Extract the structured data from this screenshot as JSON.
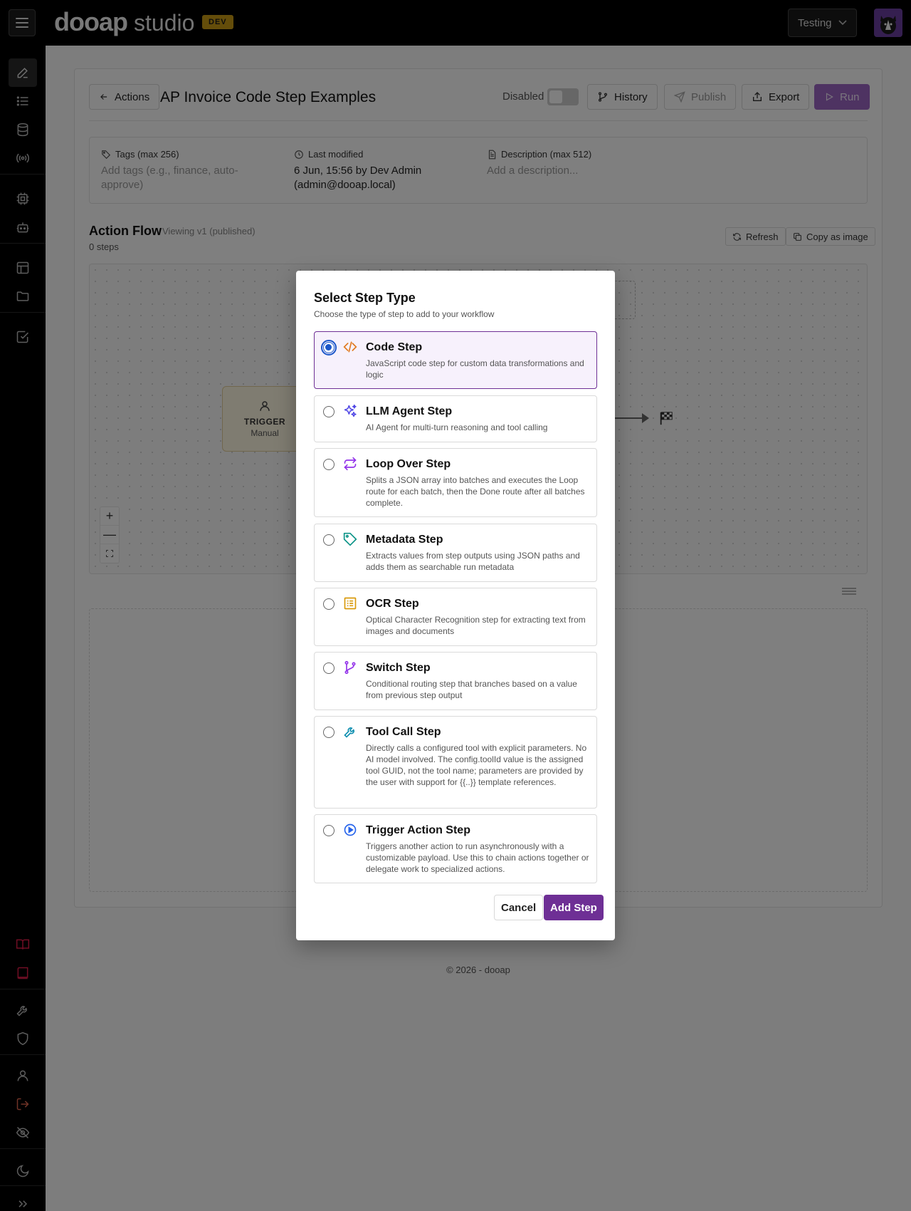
{
  "header": {
    "logo_bold": "dooap",
    "logo_rest": "studio",
    "env_badge": "DEV",
    "environment": "Testing",
    "menu_icon": "hamburger-icon",
    "avatar_icon": "dog-avatar"
  },
  "sidebar": {
    "items": [
      {
        "icon": "pencil-icon",
        "active": true
      },
      {
        "icon": "list-icon"
      },
      {
        "icon": "database-icon"
      },
      {
        "icon": "broadcast-icon"
      },
      {
        "icon": "cpu-icon"
      },
      {
        "icon": "bot-icon"
      },
      {
        "icon": "table-icon"
      },
      {
        "icon": "folder-icon"
      },
      {
        "icon": "checkbox-icon"
      },
      {
        "icon": "book-open-icon",
        "color": "#e11d48"
      },
      {
        "icon": "book-icon",
        "color": "#e11d48"
      },
      {
        "icon": "wrench-icon"
      },
      {
        "icon": "shield-icon"
      },
      {
        "icon": "user-icon"
      },
      {
        "icon": "logout-icon",
        "color": "#e0674e"
      },
      {
        "icon": "eye-off-icon"
      },
      {
        "icon": "moon-icon"
      },
      {
        "icon": "chevrons-right-icon"
      }
    ]
  },
  "page": {
    "back_label": "Actions",
    "title": "AP Invoice Code Step Examples",
    "disabled_label": "Disabled",
    "history_label": "History",
    "publish_label": "Publish",
    "export_label": "Export",
    "run_label": "Run"
  },
  "meta": {
    "tags_label": "Tags (max 256)",
    "tags_placeholder_line1": "Add tags (e.g., finance, auto-",
    "tags_placeholder_line2": "approve)",
    "modified_label": "Last modified",
    "modified_line1": "6 Jun, 15:56 by Dev Admin",
    "modified_line2": "(admin@dooap.local)",
    "desc_label": "Description (max 512)",
    "desc_placeholder": "Add a description..."
  },
  "flow": {
    "title": "Action Flow",
    "version": "Viewing v1 (published)",
    "steps_count": "0 steps",
    "refresh_label": "Refresh",
    "copy_label": "Copy as image",
    "trigger_title": "TRIGGER",
    "trigger_sub": "Manual",
    "zoom_in": "+",
    "zoom_out": "—"
  },
  "footer": "© 2026 - dooap",
  "modal": {
    "title": "Select Step Type",
    "subtitle": "Choose the type of step to add to your workflow",
    "cancel_label": "Cancel",
    "add_label": "Add Step",
    "options": [
      {
        "label": "Code Step",
        "desc": "JavaScript code step for custom data transformations and logic",
        "icon": "code-icon",
        "color": "#e07a1f",
        "selected": true
      },
      {
        "label": "LLM Agent Step",
        "desc": "AI Agent for multi-turn reasoning and tool calling",
        "icon": "sparkles-icon",
        "color": "#4f46e5",
        "selected": false
      },
      {
        "label": "Loop Over Step",
        "desc": "Splits a JSON array into batches and executes the Loop route for each batch, then the Done route after all batches complete.",
        "icon": "repeat-icon",
        "color": "#9333ea",
        "selected": false
      },
      {
        "label": "Metadata Step",
        "desc": "Extracts values from step outputs using JSON paths and adds them as searchable run metadata",
        "icon": "tag-icon",
        "color": "#0d9488",
        "selected": false
      },
      {
        "label": "OCR Step",
        "desc": "Optical Character Recognition step for extracting text from images and documents",
        "icon": "document-scan-icon",
        "color": "#d99a0b",
        "selected": false
      },
      {
        "label": "Switch Step",
        "desc": "Conditional routing step that branches based on a value from previous step output",
        "icon": "git-branch-icon",
        "color": "#9333ea",
        "selected": false
      },
      {
        "label": "Tool Call Step",
        "desc": "Directly calls a configured tool with explicit parameters. No AI model involved. The config.toolId value is the assigned tool GUID, not the tool name; parameters are provided by the user with support for {{..}} template references.",
        "icon": "wrench-icon",
        "color": "#0e8fb0",
        "selected": false
      },
      {
        "label": "Trigger Action Step",
        "desc": "Triggers another action to run asynchronously with a customizable payload. Use this to chain actions together or delegate work to specialized actions.",
        "icon": "play-circle-icon",
        "color": "#2563eb",
        "selected": false
      }
    ]
  }
}
